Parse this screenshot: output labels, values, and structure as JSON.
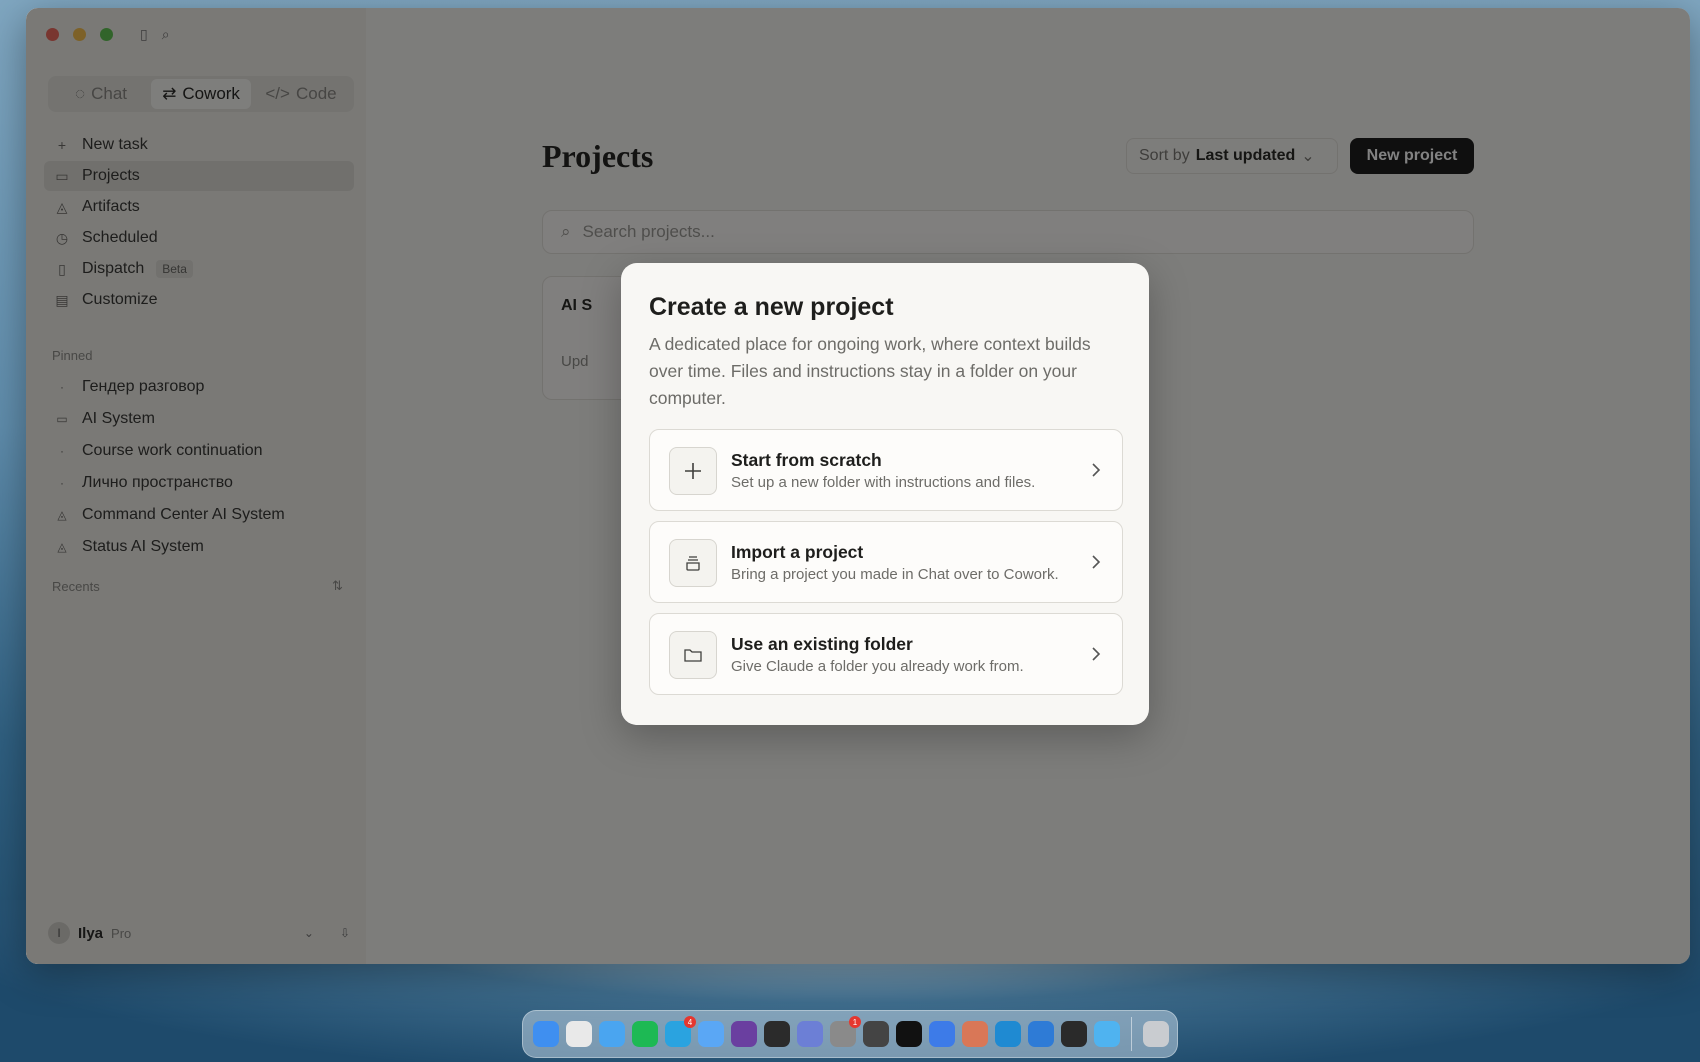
{
  "sidebar": {
    "modes": [
      {
        "label": "Chat",
        "icon": "chat-bubble-icon"
      },
      {
        "label": "Cowork",
        "icon": "cowork-icon"
      },
      {
        "label": "Code",
        "icon": "code-icon"
      }
    ],
    "nav": [
      {
        "label": "New task",
        "icon": "plus-icon"
      },
      {
        "label": "Projects",
        "icon": "folder-icon"
      },
      {
        "label": "Artifacts",
        "icon": "artifacts-icon"
      },
      {
        "label": "Scheduled",
        "icon": "clock-icon"
      },
      {
        "label": "Dispatch",
        "icon": "dispatch-icon",
        "badge": "Beta"
      },
      {
        "label": "Customize",
        "icon": "briefcase-icon"
      }
    ],
    "pinned_label": "Pinned",
    "pinned": [
      {
        "label": "Гендер разговор"
      },
      {
        "label": "AI System"
      },
      {
        "label": "Course work continuation"
      },
      {
        "label": "Лично пространство"
      },
      {
        "label": "Command Center AI System"
      },
      {
        "label": "Status AI System"
      }
    ],
    "recents_label": "Recents",
    "recents_toggle": "⇅",
    "user": {
      "initial": "I",
      "name": "Ilya",
      "plan": "Pro"
    }
  },
  "main": {
    "title": "Projects",
    "sort_prefix": "Sort by",
    "sort_value": "Last updated",
    "new_project_label": "New project",
    "search_placeholder": "Search projects...",
    "card": {
      "title": "AI S",
      "subtitle": "Upd"
    }
  },
  "modal": {
    "title": "Create a new project",
    "description": "A dedicated place for ongoing work, where context builds over time. Files and instructions stay in a folder on your computer.",
    "options": [
      {
        "title": "Start from scratch",
        "subtitle": "Set up a new folder with instructions and files.",
        "icon": "plus-icon"
      },
      {
        "title": "Import a project",
        "subtitle": "Bring a project you made in Chat over to Cowork.",
        "icon": "box-icon"
      },
      {
        "title": "Use an existing folder",
        "subtitle": "Give Claude a folder you already work from.",
        "icon": "folder-icon"
      }
    ]
  },
  "dock": {
    "apps": [
      {
        "name": "finder-icon",
        "color": "#3f8ff0"
      },
      {
        "name": "chrome-icon",
        "color": "#e9e9e9"
      },
      {
        "name": "safari-icon",
        "color": "#4aa5f0"
      },
      {
        "name": "spotify-icon",
        "color": "#1db954"
      },
      {
        "name": "telegram-icon",
        "color": "#2aa3e0",
        "badge": "4"
      },
      {
        "name": "testflight-icon",
        "color": "#5aa7f5"
      },
      {
        "name": "alfred-icon",
        "color": "#6a3fa0"
      },
      {
        "name": "calculator-grid-icon",
        "color": "#2b2b2b"
      },
      {
        "name": "simulator-icon",
        "color": "#6c7fd6"
      },
      {
        "name": "system-settings-icon",
        "color": "#8a8a8a",
        "badge": "1"
      },
      {
        "name": "calculator-icon",
        "color": "#444444"
      },
      {
        "name": "v2-icon",
        "color": "#111111"
      },
      {
        "name": "phone-icon",
        "color": "#3d7be8"
      },
      {
        "name": "claude-icon",
        "color": "#d97757"
      },
      {
        "name": "vscode-icon",
        "color": "#1f8ad2"
      },
      {
        "name": "microphone-icon",
        "color": "#2e7bd6"
      },
      {
        "name": "chatgpt-icon",
        "color": "#2a2a2a"
      },
      {
        "name": "messages-icon",
        "color": "#4fb3f0"
      },
      {
        "name": "trash-icon",
        "color": "#c9ccd0"
      }
    ]
  }
}
